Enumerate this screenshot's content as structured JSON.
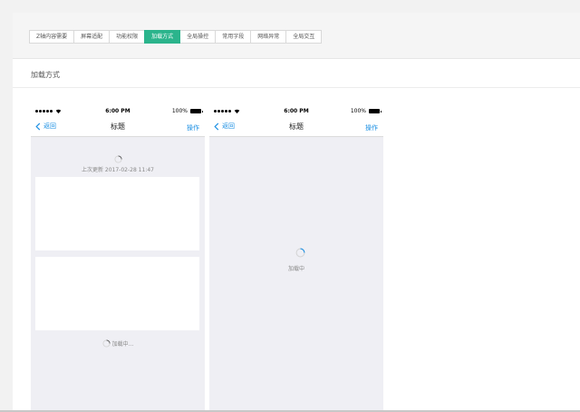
{
  "tabs": [
    {
      "label": "Z轴内容需要"
    },
    {
      "label": "屏幕适配"
    },
    {
      "label": "功能权限"
    },
    {
      "label": "加载方式",
      "active": true
    },
    {
      "label": "全局操控"
    },
    {
      "label": "常用字段"
    },
    {
      "label": "网络异常"
    },
    {
      "label": "全局交互"
    }
  ],
  "section": {
    "title": "加载方式"
  },
  "phone_left": {
    "status": {
      "time": "6:00 PM",
      "battery": "100%"
    },
    "nav": {
      "back": "返回",
      "title": "标题",
      "action": "操作"
    },
    "refresh_text": "上次更新 2017-02-28 11:47",
    "loading_text": "加载中..."
  },
  "phone_right": {
    "status": {
      "time": "6:00 PM",
      "battery": "100%"
    },
    "nav": {
      "back": "返回",
      "title": "标题",
      "action": "操作"
    },
    "loading_text": "加载中"
  },
  "colors": {
    "accent": "#2bb48c",
    "link": "#1a8fe3",
    "phone_bg": "#efeff4"
  },
  "icons": [
    "signal-dots-icon",
    "wifi-icon",
    "battery-icon",
    "chevron-left-icon",
    "spinner-icon"
  ]
}
